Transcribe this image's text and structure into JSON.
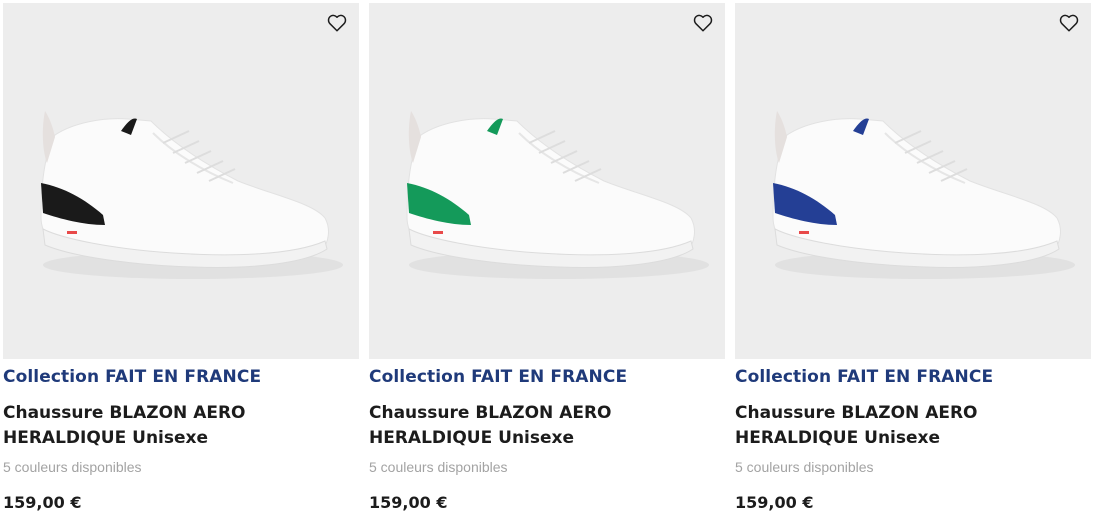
{
  "products": [
    {
      "collection": "Collection FAIT EN FRANCE",
      "title_line1": "Chaussure BLAZON AERO",
      "title_line2": "HERALDIQUE Unisexe",
      "colors_available": "5 couleurs disponibles",
      "price": "159,00 €",
      "accent_color": "#1a1a1a",
      "favorite_icon": "heart-outline-icon"
    },
    {
      "collection": "Collection FAIT EN FRANCE",
      "title_line1": "Chaussure BLAZON AERO",
      "title_line2": "HERALDIQUE Unisexe",
      "colors_available": "5 couleurs disponibles",
      "price": "159,00 €",
      "accent_color": "#149a5a",
      "favorite_icon": "heart-outline-icon"
    },
    {
      "collection": "Collection FAIT EN FRANCE",
      "title_line1": "Chaussure BLAZON AERO",
      "title_line2": "HERALDIQUE Unisexe",
      "colors_available": "5 couleurs disponibles",
      "price": "159,00 €",
      "accent_color": "#243f95",
      "favorite_icon": "heart-outline-icon"
    }
  ],
  "colors": {
    "collection_text": "#1f3a7a",
    "image_background": "#ededed",
    "secondary_text": "#a3a3a3"
  }
}
